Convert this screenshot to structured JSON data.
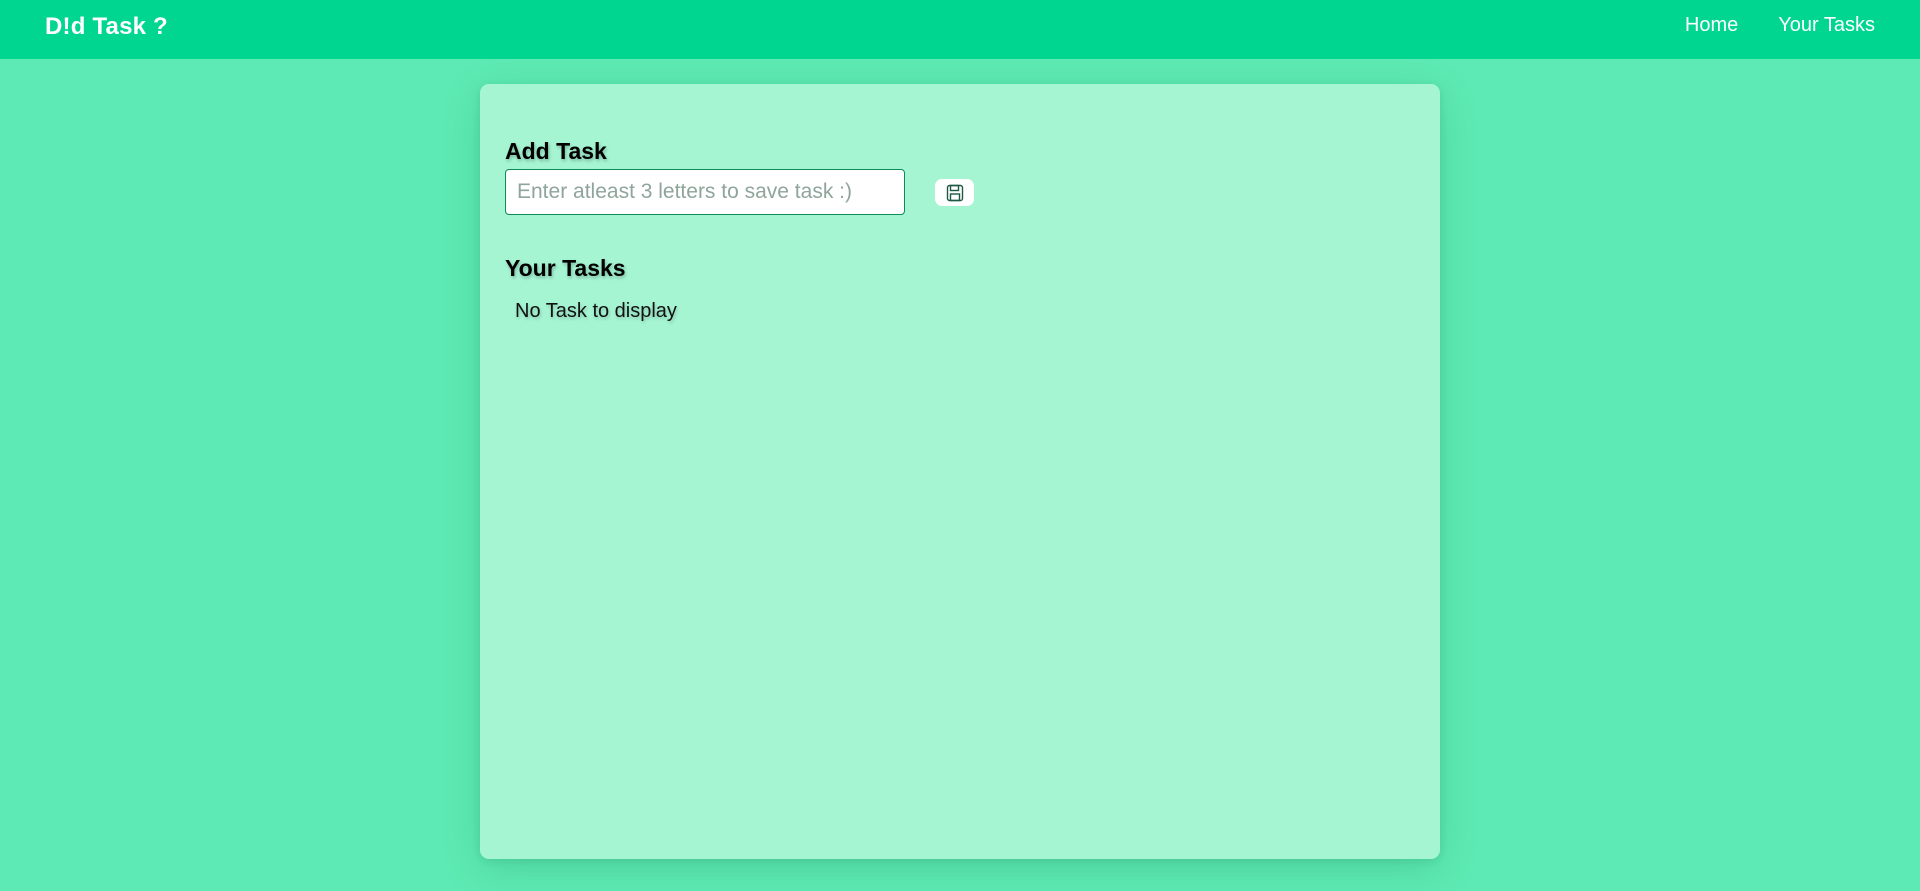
{
  "navbar": {
    "brand": "D!d Task ?",
    "links": [
      {
        "label": "Home"
      },
      {
        "label": "Your Tasks"
      }
    ]
  },
  "add_task": {
    "heading": "Add Task",
    "input_value": "",
    "input_placeholder": "Enter atleast 3 letters to save task :)",
    "save_icon": "floppy-disk-icon"
  },
  "tasks": {
    "heading": "Your Tasks",
    "empty_message": "No Task to display",
    "items": []
  },
  "colors": {
    "page_background": "#5eeab4",
    "navbar_background": "#00d690",
    "card_background": "#a5f5d3",
    "input_border": "#0e8a5a"
  }
}
